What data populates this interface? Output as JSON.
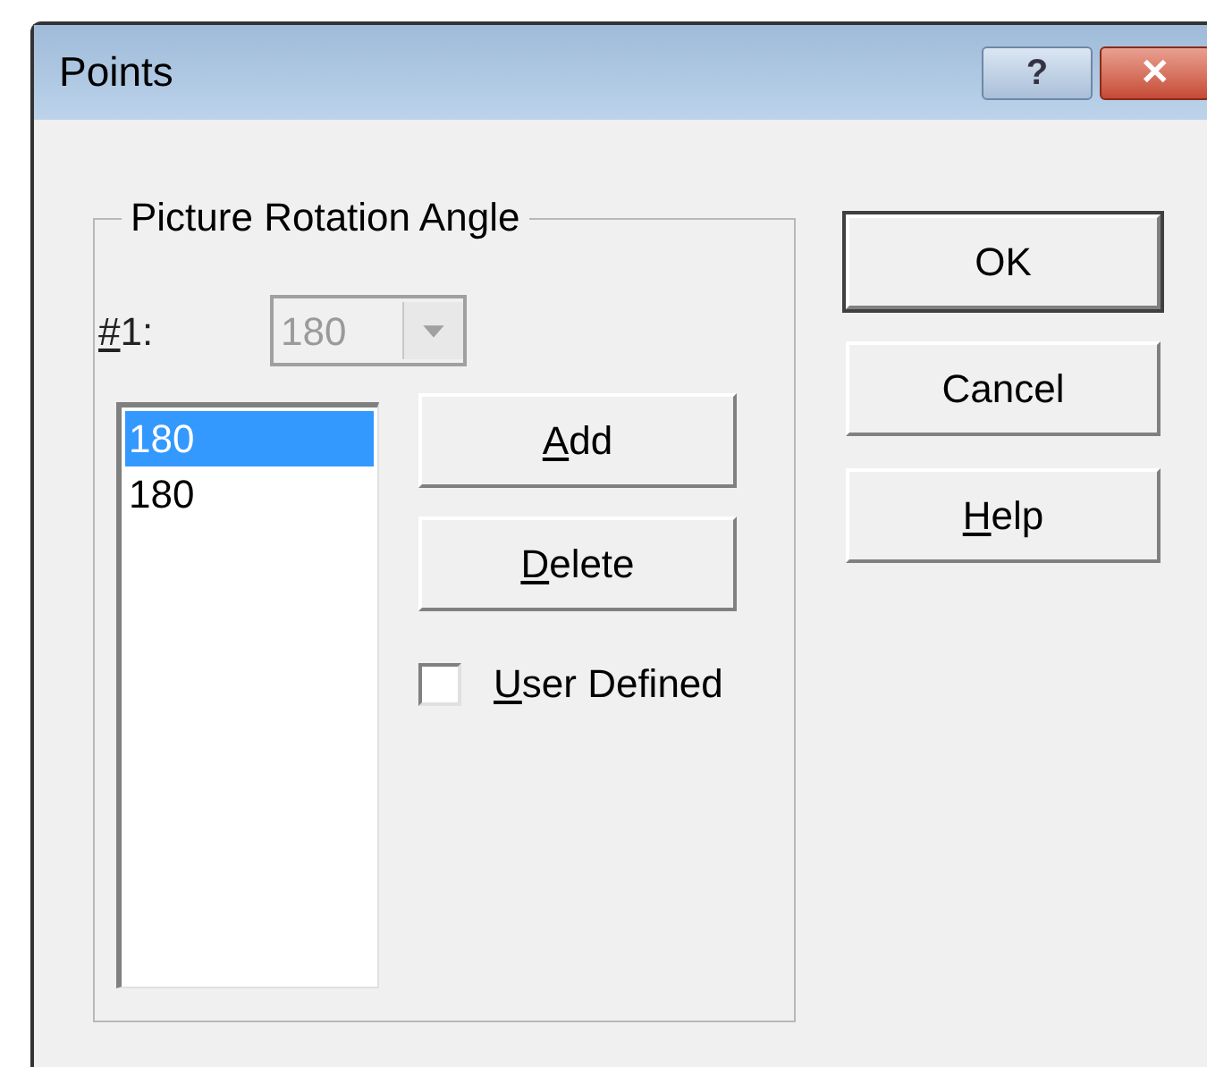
{
  "window": {
    "title": "Points"
  },
  "title_buttons": [
    {
      "kind": "help",
      "label": "?"
    },
    {
      "kind": "close",
      "label": "✕"
    }
  ],
  "group": {
    "title": "Picture Rotation Angle",
    "combo": {
      "label": "#1:",
      "mnemonic": true,
      "value": "180",
      "disabled": true
    },
    "list": [
      {
        "text": "180",
        "selected": true
      },
      {
        "text": "180",
        "selected": false
      }
    ],
    "buttons": [
      {
        "label": "Add",
        "mnemonic": true
      },
      {
        "label": "Delete",
        "mnemonic": true
      }
    ],
    "checkbox": {
      "label": "User Defined",
      "mnemonic": true,
      "checked": false
    }
  },
  "dialog_buttons": [
    {
      "label": "OK",
      "mnemonic": false,
      "default": true
    },
    {
      "label": "Cancel",
      "mnemonic": false,
      "default": false
    },
    {
      "label": "Help",
      "mnemonic": true,
      "default": false
    }
  ]
}
